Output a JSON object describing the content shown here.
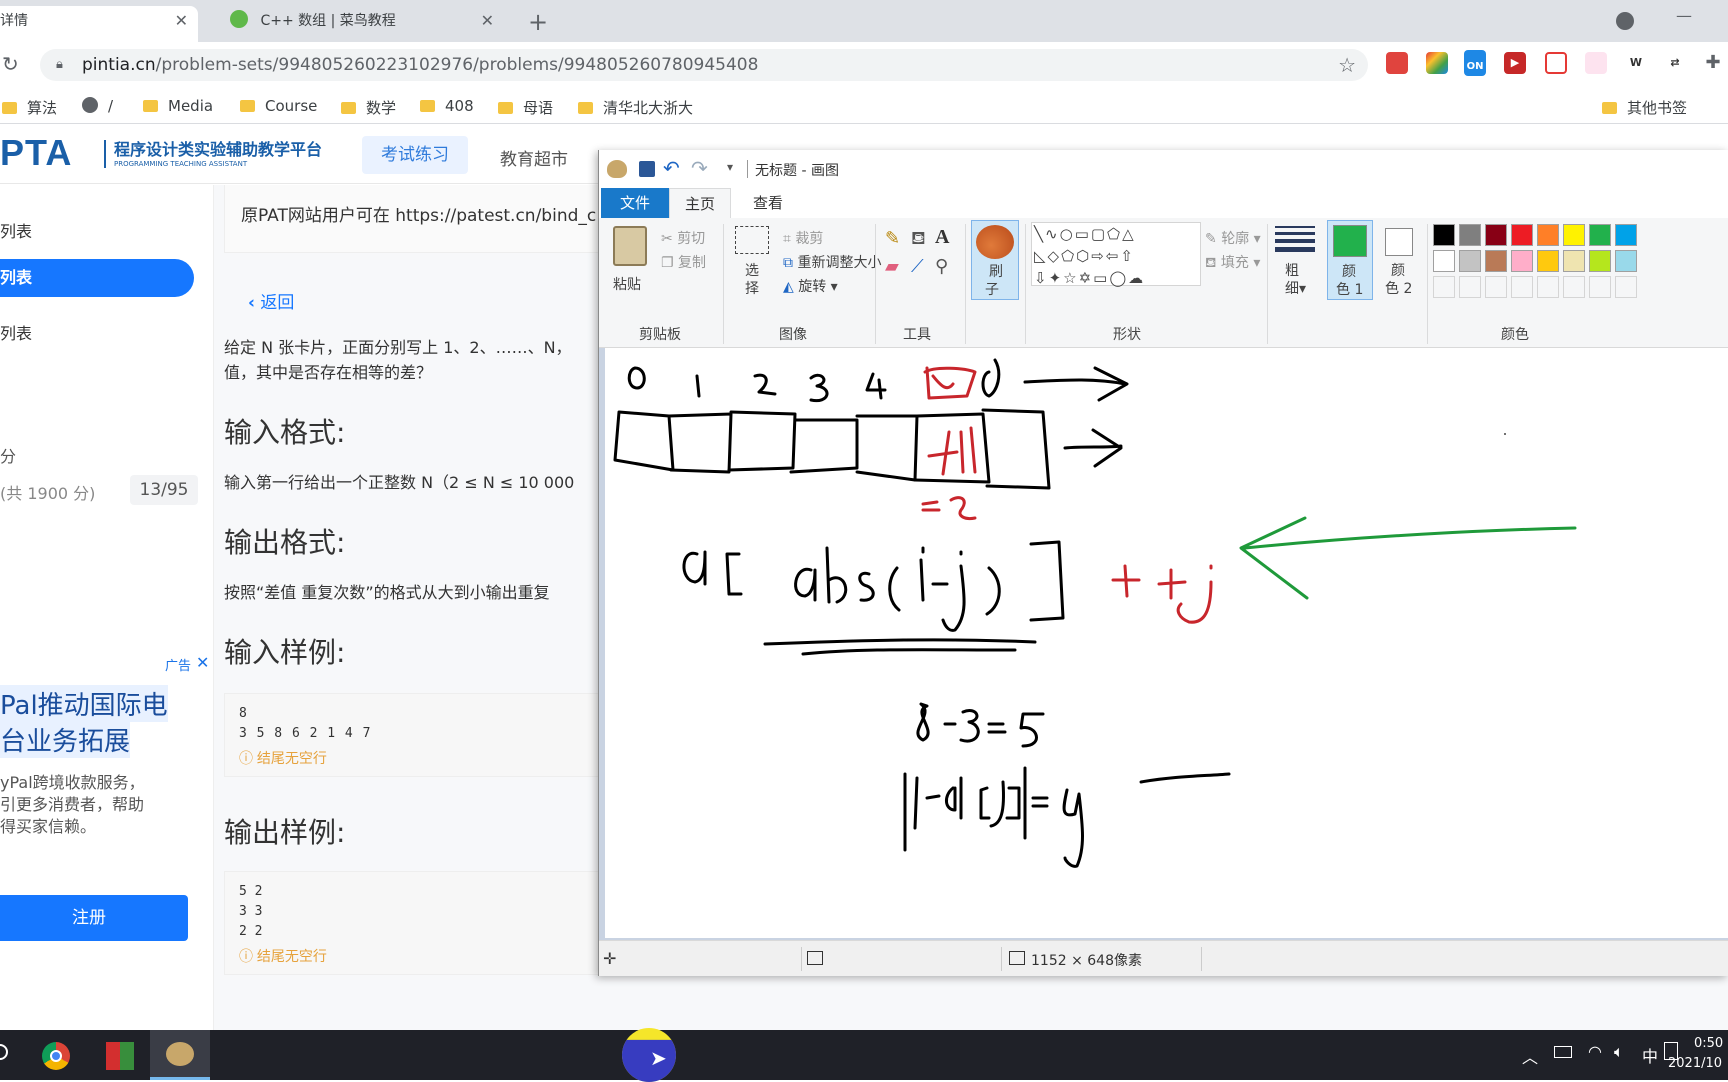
{
  "browser": {
    "tabs": [
      {
        "label": "详情",
        "active": true
      },
      {
        "label": "C++ 数组 | 菜鸟教程",
        "active": false
      }
    ],
    "url_host": "pintia.cn",
    "url_path": "/problem-sets/994805260223102976/problems/994805260780945408",
    "bookmarks": [
      "算法",
      "/",
      "Media",
      "Course",
      "数学",
      "408",
      "母语",
      "清华北大浙大"
    ],
    "other_bookmarks": "其他书签",
    "extension_on": "ON"
  },
  "pta": {
    "logo": "PTA",
    "platform_name": "程序设计类实验辅助教学平台",
    "platform_sub": "PROGRAMMING TEACHING ASSISTANT",
    "nav": [
      "考试练习",
      "教育超市"
    ],
    "left_items": [
      "列表",
      "列表",
      "列表"
    ],
    "left_score_label": "分",
    "left_total": "(共 1900 分)",
    "left_progress": "13/95",
    "notice": "原PAT网站用户可在 https://patest.cn/bind_c",
    "back": "返回",
    "desc_line1": "给定 N 张卡片，正面分别写上 1、2、……、N，",
    "desc_line2": "值，其中是否存在相等的差？",
    "h_input": "输入格式:",
    "input_text": "输入第一行给出一个正整数 N（2 ≤ N ≤ 10 000",
    "h_output": "输出格式:",
    "output_text": "按照“差值 重复次数”的格式从大到小输出重复",
    "h_sample_in": "输入样例:",
    "sample_in": [
      "8",
      "3 5 8 6 2 1 4 7"
    ],
    "no_trailing": "结尾无空行",
    "h_sample_out": "输出样例:",
    "sample_out": [
      "5 2",
      "3 3",
      "2 2"
    ],
    "ad_label": "广告",
    "ad_title_1": "Pal推动国际电",
    "ad_title_2": "台业务拓展",
    "ad_body_1": "yPal跨境收款服务，",
    "ad_body_2": "引更多消费者，帮助",
    "ad_body_3": "得买家信赖。",
    "register": "注册"
  },
  "paint": {
    "title": "无标题 - 画图",
    "tabs": [
      "文件",
      "主页",
      "查看"
    ],
    "clipboard": {
      "paste": "粘贴",
      "cut": "剪切",
      "copy": "复制",
      "label": "剪贴板"
    },
    "image": {
      "select_1": "选",
      "select_2": "择",
      "crop": "裁剪",
      "resize": "重新调整大小",
      "rotate": "旋转",
      "label": "图像"
    },
    "tools_label": "工具",
    "brush_1": "刷",
    "brush_2": "子",
    "shapes": {
      "outline": "轮廓",
      "fill": "填充",
      "label": "形状"
    },
    "size_1": "粗",
    "size_2": "细",
    "color1_1": "颜",
    "color1_2": "色 1",
    "color2_1": "颜",
    "color2_2": "色 2",
    "colors_label": "颜色",
    "palette_row1": [
      "#000000",
      "#7f7f7f",
      "#880015",
      "#ed1c24",
      "#ff7f27",
      "#fff200",
      "#22b14c",
      "#00a2e8"
    ],
    "palette_row2": [
      "#ffffff",
      "#c3c3c3",
      "#b97a57",
      "#ffaec9",
      "#ffc90e",
      "#efe4b0",
      "#b5e61d",
      "#99d9ea"
    ],
    "color1": "#22b14c",
    "canvas_size": "1152 × 648像素"
  },
  "taskbar": {
    "time": "0:50",
    "date": "2021/10",
    "ime": "中"
  }
}
